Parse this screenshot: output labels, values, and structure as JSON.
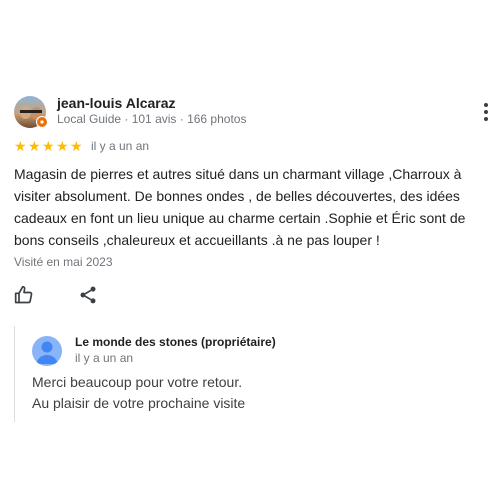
{
  "review": {
    "author_name": "jean-louis Alcaraz",
    "author_meta": "Local Guide · 101 avis · 166 photos",
    "rating": 5,
    "max_rating": 5,
    "time": "il y a un an",
    "text": "Magasin de pierres et autres situé dans un charmant village ,Charroux à visiter absolument. De bonnes ondes , de belles découvertes, des idées cadeaux en font un lieu unique au charme certain .Sophie et Éric sont de bons conseils ,chaleureux et accueillants .à ne pas louper !",
    "visited": "Visité en mai 2023"
  },
  "reply": {
    "owner_name": "Le monde des stones (propriétaire)",
    "time": "il y a un an",
    "lines": [
      "Merci beaucoup pour votre retour.",
      "Au plaisir de votre prochaine visite"
    ]
  },
  "colors": {
    "star": "#fbbc04",
    "badge": "#e8710a",
    "owner_avatar": "#8ab4f8"
  },
  "icons": {
    "more": "more-vertical-icon",
    "like": "thumb-up-icon",
    "share": "share-icon"
  }
}
